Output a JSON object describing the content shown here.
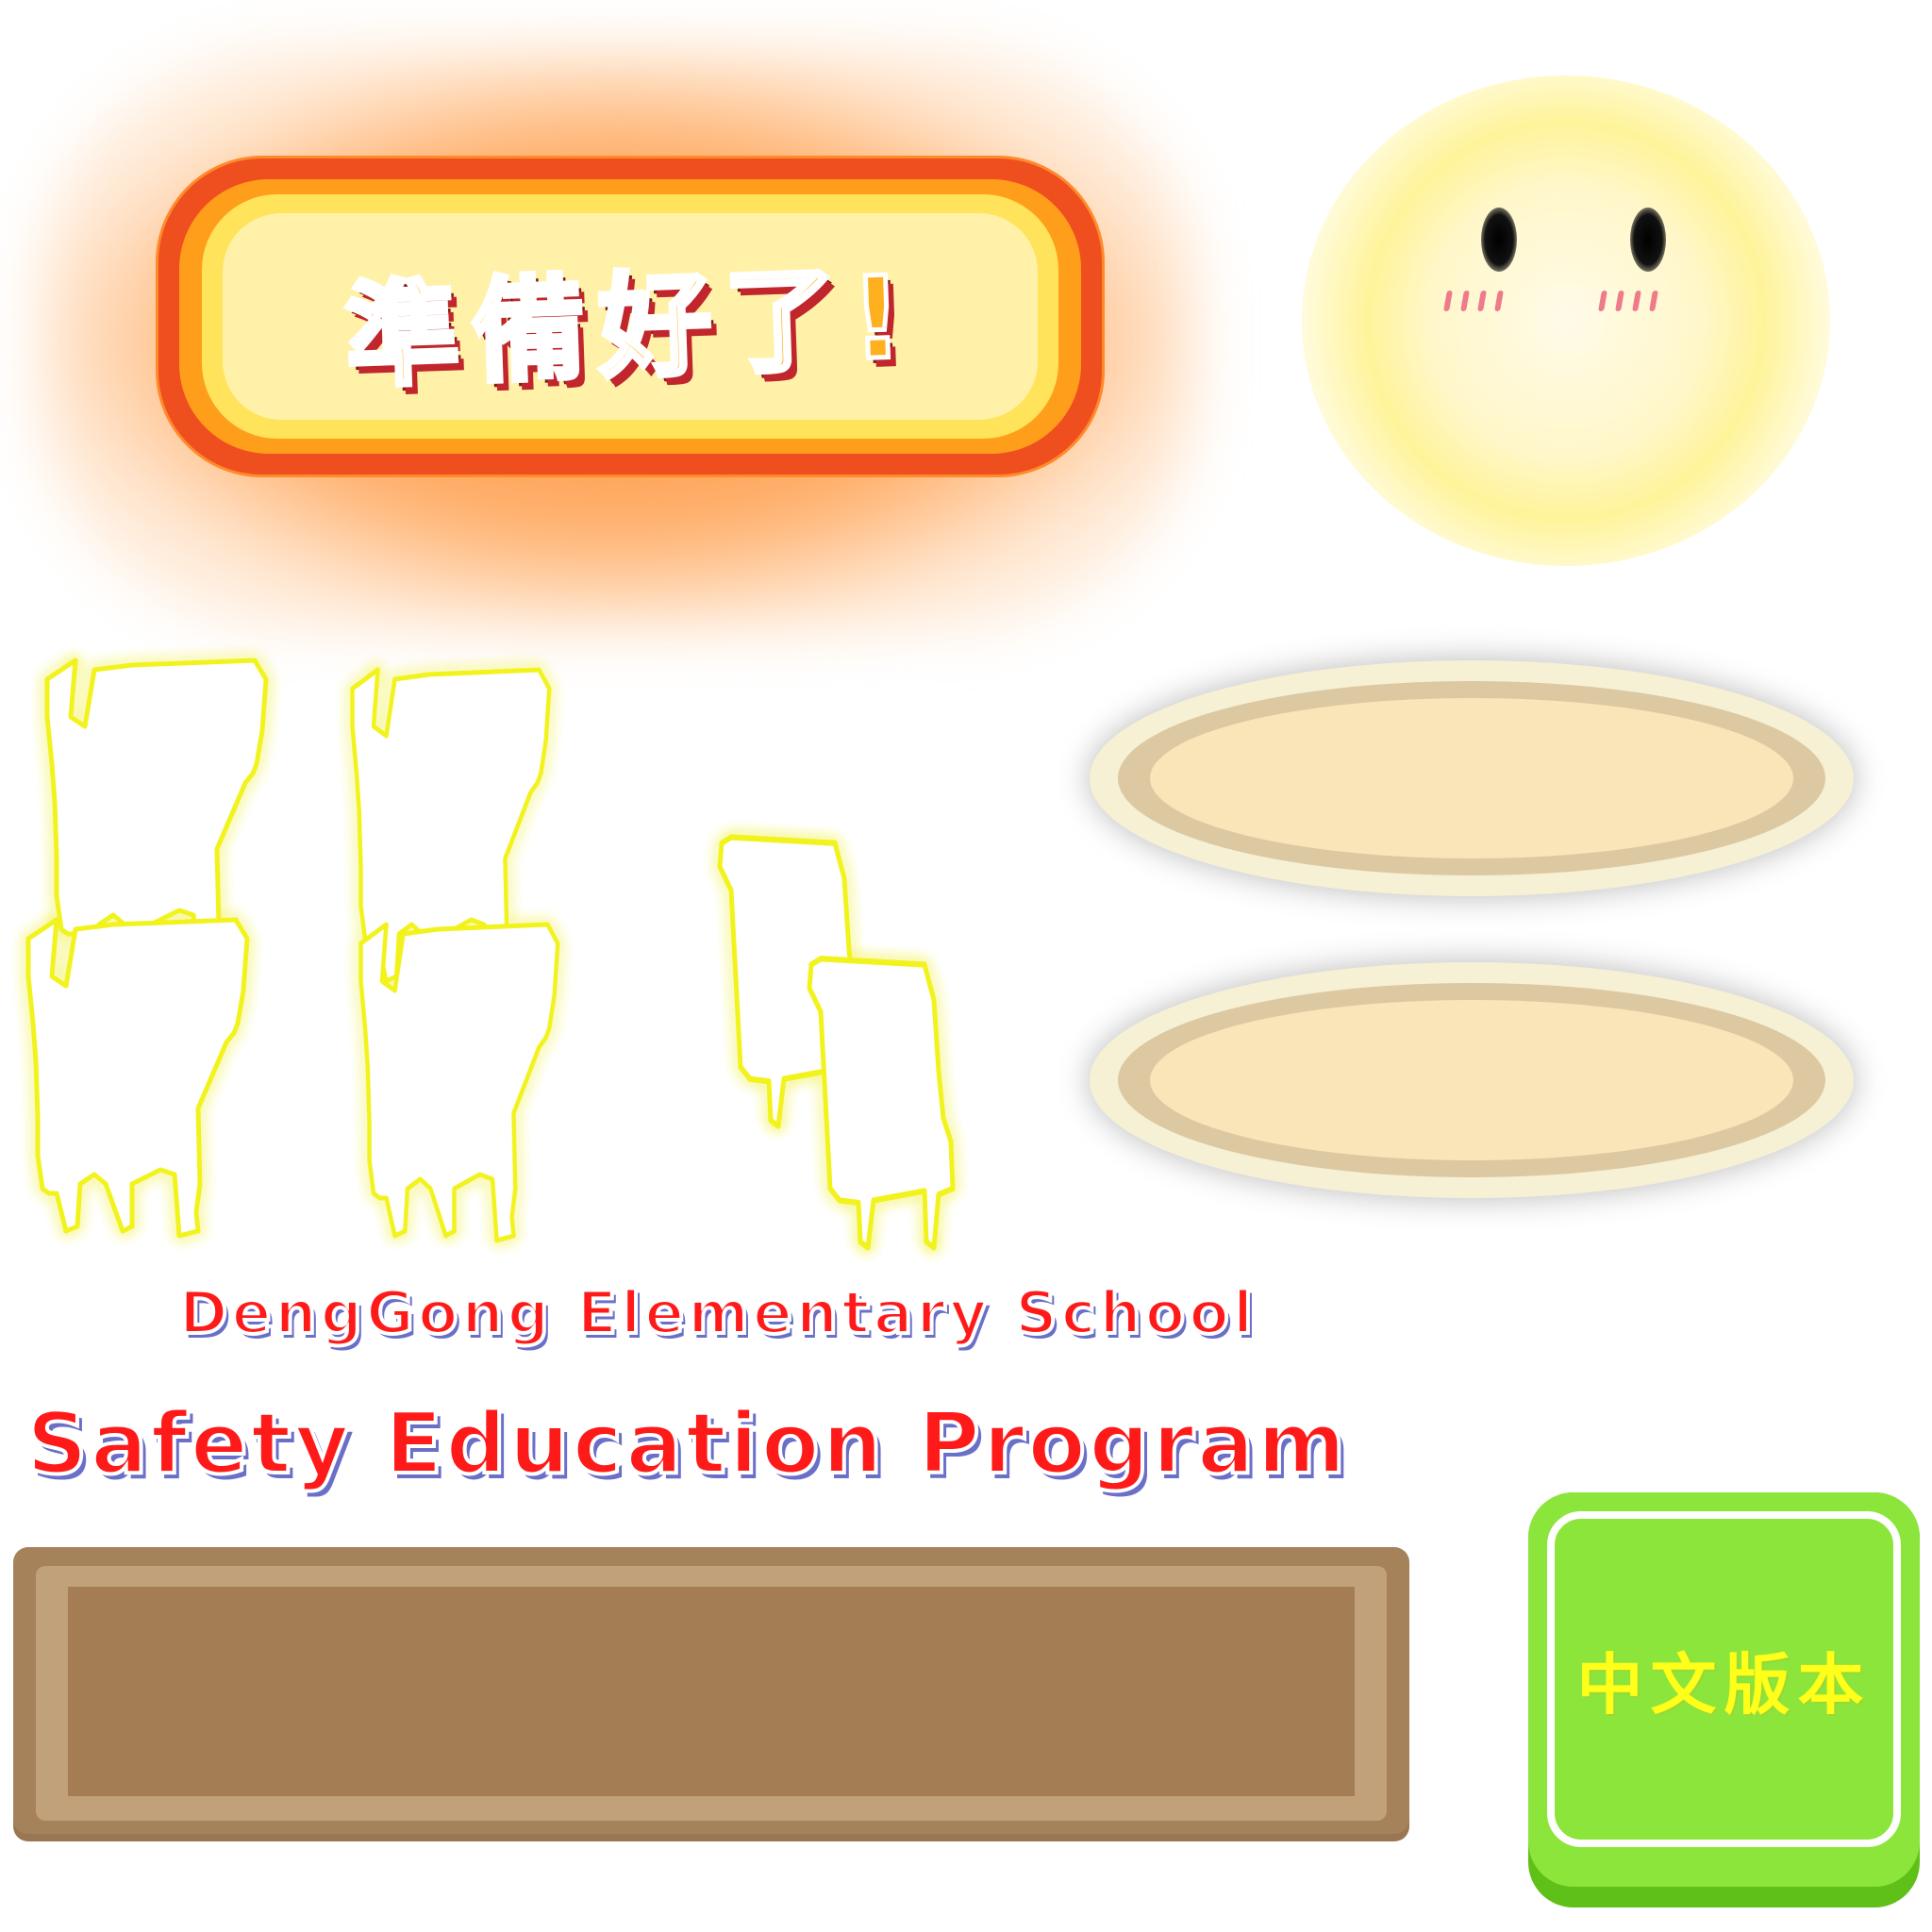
{
  "ready_button": {
    "label": "準備好了!"
  },
  "sun": {
    "icon": "sun-face-icon"
  },
  "chairs": {
    "icon": "chair-outline-icon",
    "count": 6,
    "glow_color": "#ffff33"
  },
  "plates": {
    "icon": "plate-icon",
    "count": 2
  },
  "school_name": "DengGong Elementary School",
  "program_name": "Safety Education Program",
  "board": {
    "icon": "wooden-board-icon"
  },
  "language_button": {
    "label": "中文版本"
  },
  "colors": {
    "title_red": "#ff1a1a",
    "ready_orange": "#ff9e1a",
    "language_green": "#8be53a",
    "language_text": "#ffff1a"
  }
}
